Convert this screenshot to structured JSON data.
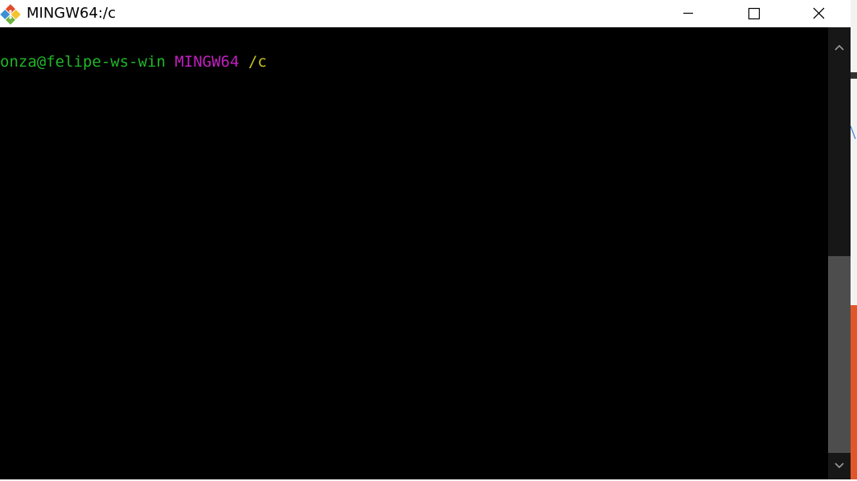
{
  "window": {
    "title": "MINGW64:/c"
  },
  "terminal": {
    "prompt_user_host": "onza@felipe-ws-win",
    "prompt_system": "MINGW64",
    "prompt_path": "/c",
    "colors": {
      "background": "#000000",
      "user_host": "#1fb529",
      "system": "#c01fc0",
      "path": "#c6c21f"
    }
  },
  "icons": {
    "app": "git-bash-diamond-icon",
    "minimize": "minimize-icon",
    "maximize": "maximize-icon",
    "close": "close-icon",
    "scroll_up": "chevron-up-icon",
    "scroll_down": "chevron-down-icon"
  }
}
